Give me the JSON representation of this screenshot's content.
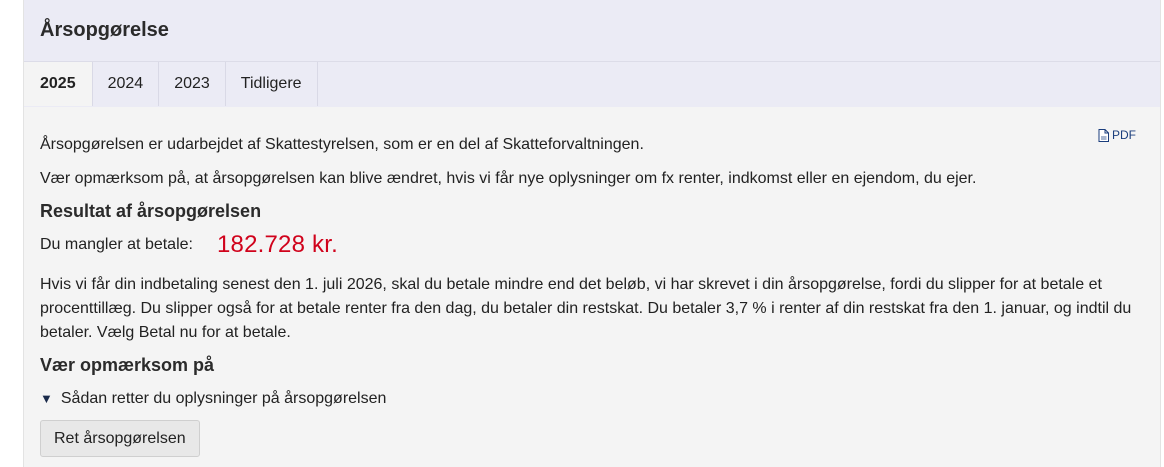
{
  "panel": {
    "title": "Årsopgørelse"
  },
  "tabs": [
    {
      "label": "2025",
      "active": true
    },
    {
      "label": "2024",
      "active": false
    },
    {
      "label": "2023",
      "active": false
    },
    {
      "label": "Tidligere",
      "active": false
    }
  ],
  "content": {
    "pdf_label": "PDF",
    "intro": "Årsopgørelsen er udarbejdet af Skattestyrelsen, som er en del af Skatteforvaltningen.",
    "notice": "Vær opmærksom på, at årsopgørelsen kan blive ændret, hvis vi får nye oplysninger om fx renter, indkomst eller en ejendom, du ejer.",
    "result_heading": "Resultat af årsopgørelsen",
    "due_label": "Du mangler at betale:",
    "due_amount": "182.728 kr.",
    "payment_info": "Hvis vi får din indbetaling senest den 1. juli 2026, skal du betale mindre end det beløb, vi har skrevet i din årsopgørelse, fordi du slipper for at betale et procenttillæg. Du slipper også for at betale renter fra den dag, du betaler din restskat. Du betaler 3,7 % i renter af din restskat fra den 1. januar, og indtil du betaler. Vælg Betal nu for at betale.",
    "note_heading": "Vær opmærksom på",
    "details_label": "Sådan retter du oplysninger på årsopgørelsen",
    "correct_button": "Ret årsopgørelsen"
  },
  "colors": {
    "amount_due": "#d0021b",
    "header_bg": "#ebebf5",
    "panel_bg": "#f4f4f4"
  }
}
